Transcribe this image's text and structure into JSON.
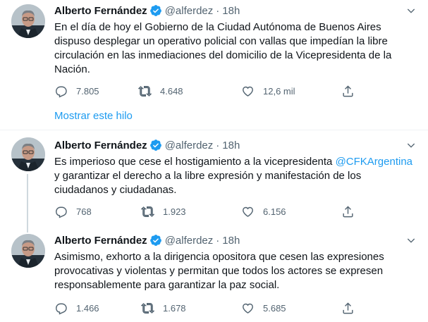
{
  "tweets": [
    {
      "name": "Alberto Fernández",
      "handle": "@alferdez",
      "separator": "·",
      "time": "18h",
      "text": "En el día de hoy el Gobierno de la Ciudad Autónoma de Buenos Aires dispuso desplegar un operativo policial con vallas que impedían la libre circulación en las inmediaciones del domicilio de la Vicepresidenta de la Nación.",
      "replies": "7.805",
      "retweets": "4.648",
      "likes": "12,6 mil"
    },
    {
      "name": "Alberto Fernández",
      "handle": "@alferdez",
      "separator": "·",
      "time": "18h",
      "text_before": "Es imperioso que cese el hostigamiento a la vicepresidenta ",
      "mention": "@CFKArgentina",
      "text_after": " y garantizar el derecho a la libre expresión y manifestación de los ciudadanos y ciudadanas.",
      "replies": "768",
      "retweets": "1.923",
      "likes": "6.156"
    },
    {
      "name": "Alberto Fernández",
      "handle": "@alferdez",
      "separator": "·",
      "time": "18h",
      "text": "Asimismo, exhorto a la dirigencia opositora que cesen las expresiones provocativas y violentas y permitan que todos los actores se expresen responsablemente para garantizar la paz social.",
      "replies": "1.466",
      "retweets": "1.678",
      "likes": "5.685"
    }
  ],
  "show_thread_label": "Mostrar este hilo",
  "colors": {
    "accent": "#1d9bf0",
    "muted": "#536471",
    "text": "#0f1419",
    "divider": "#eff3f4"
  },
  "icons": [
    "verified-badge-icon",
    "caret-down-icon",
    "reply-icon",
    "retweet-icon",
    "like-icon",
    "share-icon"
  ]
}
